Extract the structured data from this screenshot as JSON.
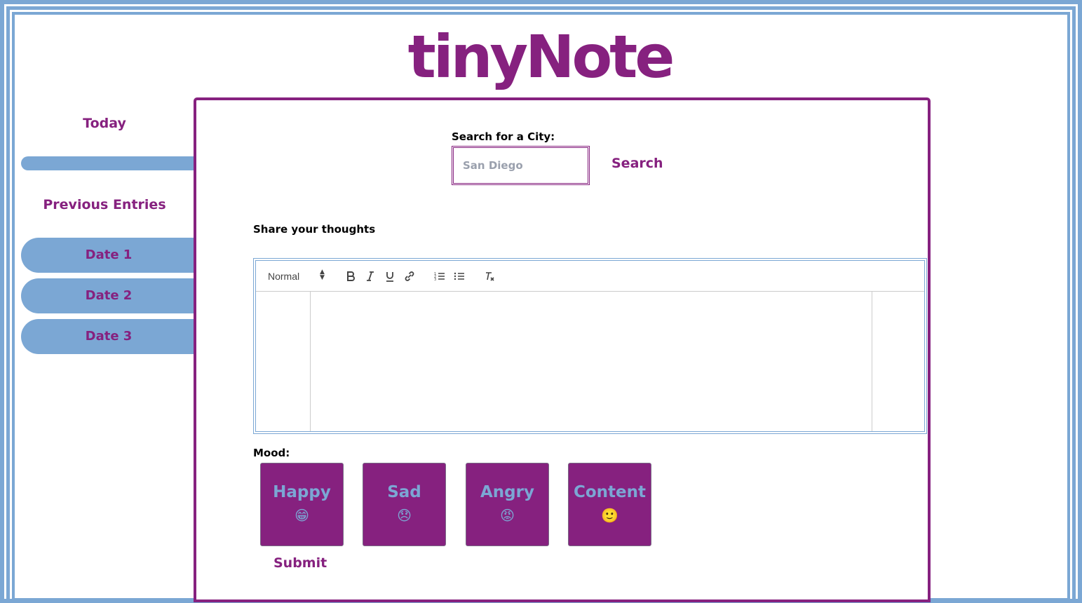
{
  "app": {
    "title": "tinyNote"
  },
  "sidebar": {
    "today_label": "Today",
    "previous_label": "Previous Entries",
    "dates": [
      {
        "label": "Date 1"
      },
      {
        "label": "Date 2"
      },
      {
        "label": "Date 3"
      }
    ]
  },
  "search": {
    "label": "Search for a City:",
    "placeholder": "San Diego",
    "button_label": "Search"
  },
  "thoughts": {
    "label": "Share your thoughts"
  },
  "editor": {
    "format_select": "Normal",
    "tools": [
      "bold-icon",
      "italic-icon",
      "underline-icon",
      "link-icon",
      "ordered-list-icon",
      "bullet-list-icon",
      "clear-format-icon"
    ]
  },
  "mood": {
    "label": "Mood:",
    "options": [
      {
        "label": "Happy",
        "emoji": "😁"
      },
      {
        "label": "Sad",
        "emoji": "😞"
      },
      {
        "label": "Angry",
        "emoji": "😡"
      },
      {
        "label": "Content",
        "emoji": "🙂"
      }
    ]
  },
  "submit": {
    "label": "Submit"
  },
  "colors": {
    "primary": "#86217f",
    "accent": "#7ba7d4",
    "background": "#ffffff"
  }
}
